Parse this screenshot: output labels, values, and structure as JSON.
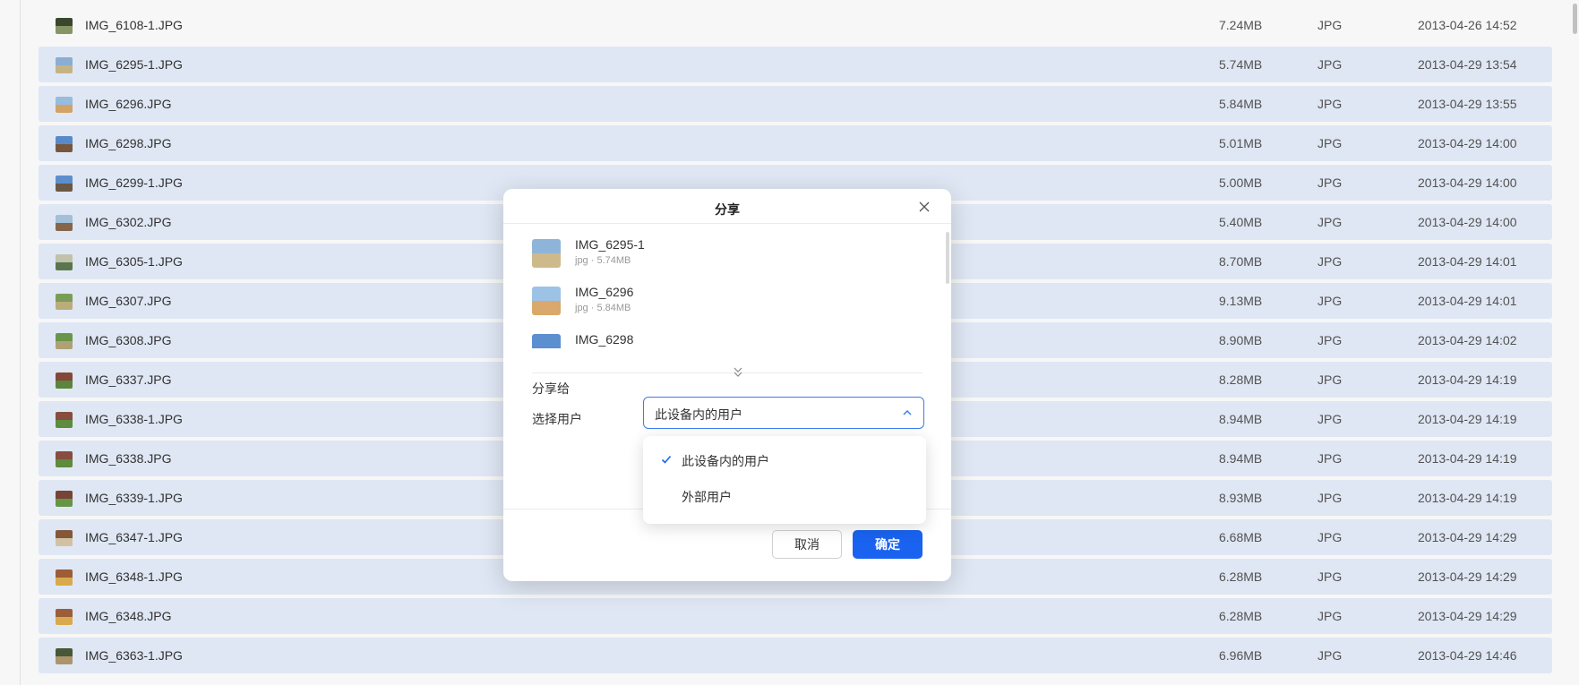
{
  "files": [
    {
      "name": "IMG_6108-1.JPG",
      "size": "7.24MB",
      "type": "JPG",
      "date": "2013-04-26 14:52",
      "selected": false,
      "thumb": [
        "#3c4a2e",
        "#8b9a6a"
      ]
    },
    {
      "name": "IMG_6295-1.JPG",
      "size": "5.74MB",
      "type": "JPG",
      "date": "2013-04-29 13:54",
      "selected": true,
      "thumb": [
        "#8fb4d9",
        "#cdb98a"
      ]
    },
    {
      "name": "IMG_6296.JPG",
      "size": "5.84MB",
      "type": "JPG",
      "date": "2013-04-29 13:55",
      "selected": true,
      "thumb": [
        "#9cc3e6",
        "#d9a86a"
      ]
    },
    {
      "name": "IMG_6298.JPG",
      "size": "5.01MB",
      "type": "JPG",
      "date": "2013-04-29 14:00",
      "selected": true,
      "thumb": [
        "#5b8fd0",
        "#7a5a40"
      ]
    },
    {
      "name": "IMG_6299-1.JPG",
      "size": "5.00MB",
      "type": "JPG",
      "date": "2013-04-29 14:00",
      "selected": true,
      "thumb": [
        "#5f93d4",
        "#6e5a48"
      ]
    },
    {
      "name": "IMG_6302.JPG",
      "size": "5.40MB",
      "type": "JPG",
      "date": "2013-04-29 14:00",
      "selected": true,
      "thumb": [
        "#a9c6e0",
        "#8a6a50"
      ]
    },
    {
      "name": "IMG_6305-1.JPG",
      "size": "8.70MB",
      "type": "JPG",
      "date": "2013-04-29 14:01",
      "selected": true,
      "thumb": [
        "#c9c9b0",
        "#5e7a50"
      ]
    },
    {
      "name": "IMG_6307.JPG",
      "size": "9.13MB",
      "type": "JPG",
      "date": "2013-04-29 14:01",
      "selected": true,
      "thumb": [
        "#7da35a",
        "#c2b280"
      ]
    },
    {
      "name": "IMG_6308.JPG",
      "size": "8.90MB",
      "type": "JPG",
      "date": "2013-04-29 14:02",
      "selected": true,
      "thumb": [
        "#6d9a4e",
        "#b5a77a"
      ]
    },
    {
      "name": "IMG_6337.JPG",
      "size": "8.28MB",
      "type": "JPG",
      "date": "2013-04-29 14:19",
      "selected": true,
      "thumb": [
        "#8a4a3a",
        "#5e8a3e"
      ]
    },
    {
      "name": "IMG_6338-1.JPG",
      "size": "8.94MB",
      "type": "JPG",
      "date": "2013-04-29 14:19",
      "selected": true,
      "thumb": [
        "#8c5040",
        "#62903f"
      ]
    },
    {
      "name": "IMG_6338.JPG",
      "size": "8.94MB",
      "type": "JPG",
      "date": "2013-04-29 14:19",
      "selected": true,
      "thumb": [
        "#8c5040",
        "#62903f"
      ]
    },
    {
      "name": "IMG_6339-1.JPG",
      "size": "8.93MB",
      "type": "JPG",
      "date": "2013-04-29 14:19",
      "selected": true,
      "thumb": [
        "#7a4838",
        "#6a9a48"
      ]
    },
    {
      "name": "IMG_6347-1.JPG",
      "size": "6.68MB",
      "type": "JPG",
      "date": "2013-04-29 14:29",
      "selected": true,
      "thumb": [
        "#8a5a3a",
        "#d8c8a8"
      ]
    },
    {
      "name": "IMG_6348-1.JPG",
      "size": "6.28MB",
      "type": "JPG",
      "date": "2013-04-29 14:29",
      "selected": true,
      "thumb": [
        "#a2603a",
        "#e0b050"
      ]
    },
    {
      "name": "IMG_6348.JPG",
      "size": "6.28MB",
      "type": "JPG",
      "date": "2013-04-29 14:29",
      "selected": true,
      "thumb": [
        "#a2603a",
        "#e0b050"
      ]
    },
    {
      "name": "IMG_6363-1.JPG",
      "size": "6.96MB",
      "type": "JPG",
      "date": "2013-04-29 14:46",
      "selected": true,
      "thumb": [
        "#4a5a3a",
        "#b09a70"
      ]
    }
  ],
  "dialog": {
    "title": "分享",
    "files": [
      {
        "name": "IMG_6295-1",
        "meta": "jpg · 5.74MB",
        "thumb": [
          "#8fb4d9",
          "#cdb98a"
        ]
      },
      {
        "name": "IMG_6296",
        "meta": "jpg · 5.84MB",
        "thumb": [
          "#9cc3e6",
          "#d9a86a"
        ]
      },
      {
        "name": "IMG_6298",
        "meta": "",
        "thumb": [
          "#5b8fd0",
          "#7a5a40"
        ]
      }
    ],
    "share_to_label": "分享给",
    "share_to_value": "此设备内的用户",
    "select_user_label": "选择用户",
    "cancel_label": "取消",
    "ok_label": "确定",
    "dropdown_options": [
      {
        "label": "此设备内的用户",
        "checked": true
      },
      {
        "label": "外部用户",
        "checked": false
      }
    ]
  },
  "colors": {
    "accent": "#1a63f0",
    "row_selected": "#e7effc"
  },
  "icons": {
    "close": "close-icon",
    "expand": "double-chevron-down-icon",
    "select_chevron": "chevron-up-icon",
    "check": "check-icon"
  }
}
